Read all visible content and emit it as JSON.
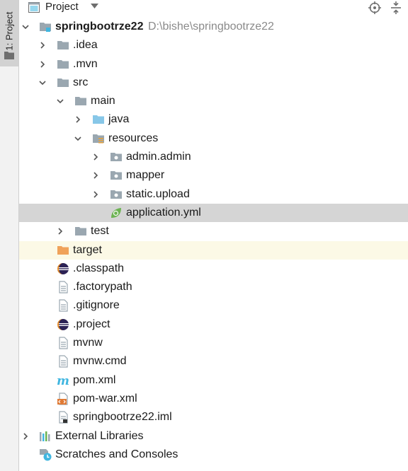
{
  "window": {
    "side_tab_label": "1: Project",
    "header_title": "Project"
  },
  "tree": [
    {
      "label": "springbootrze22",
      "location": "D:\\bishe\\springbootrze22",
      "icon": "module-folder-icon",
      "expanded": true,
      "bold": true
    },
    {
      "label": ".idea",
      "icon": "folder-icon",
      "expanded": false
    },
    {
      "label": ".mvn",
      "icon": "folder-icon",
      "expanded": false
    },
    {
      "label": "src",
      "icon": "folder-icon",
      "expanded": true
    },
    {
      "label": "main",
      "icon": "folder-icon",
      "expanded": true
    },
    {
      "label": "java",
      "icon": "source-folder-icon",
      "expanded": false
    },
    {
      "label": "resources",
      "icon": "resources-folder-icon",
      "expanded": true
    },
    {
      "label": "admin.admin",
      "icon": "package-icon",
      "expanded": false
    },
    {
      "label": "mapper",
      "icon": "package-icon",
      "expanded": false
    },
    {
      "label": "static.upload",
      "icon": "package-icon",
      "expanded": false
    },
    {
      "label": "application.yml",
      "icon": "spring-yml-icon",
      "selected": true
    },
    {
      "label": "test",
      "icon": "folder-icon",
      "expanded": false
    },
    {
      "label": "target",
      "icon": "excluded-folder-icon",
      "excluded": true
    },
    {
      "label": ".classpath",
      "icon": "eclipse-icon"
    },
    {
      "label": ".factorypath",
      "icon": "file-icon"
    },
    {
      "label": ".gitignore",
      "icon": "file-icon"
    },
    {
      "label": ".project",
      "icon": "eclipse-icon"
    },
    {
      "label": "mvnw",
      "icon": "file-icon"
    },
    {
      "label": "mvnw.cmd",
      "icon": "file-icon"
    },
    {
      "label": "pom.xml",
      "icon": "maven-icon"
    },
    {
      "label": "pom-war.xml",
      "icon": "xml-file-icon"
    },
    {
      "label": "springbootrze22.iml",
      "icon": "iml-file-icon"
    },
    {
      "label": "External Libraries",
      "icon": "libraries-icon",
      "expanded": false
    },
    {
      "label": "Scratches and Consoles",
      "icon": "scratches-icon"
    }
  ],
  "colors": {
    "selected_row": "#d5d5d5",
    "excluded_row": "#fcf9e6",
    "folder": "#9aa7b0",
    "source_folder": "#87c7e8",
    "excluded_folder": "#f0a25a",
    "module_badge": "#40b6e0",
    "spring_green": "#6cb352",
    "maven_blue": "#40b6e0"
  }
}
